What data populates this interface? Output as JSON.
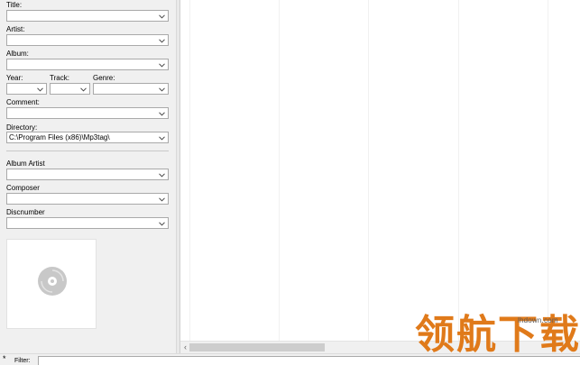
{
  "tag_panel": {
    "title_label": "Title:",
    "artist_label": "Artist:",
    "album_label": "Album:",
    "year_label": "Year:",
    "track_label": "Track:",
    "genre_label": "Genre:",
    "comment_label": "Comment:",
    "directory_label": "Directory:",
    "directory_value": "C:\\Program Files (x86)\\Mp3tag\\",
    "album_artist_label": "Album Artist",
    "composer_label": "Composer",
    "discnumber_label": "Discnumber",
    "cover_icon": "disc-icon"
  },
  "filter_bar": {
    "marker": "*",
    "label": "Filter:",
    "value": ""
  },
  "watermark": {
    "url": "lhdown.com",
    "text": "领航下载"
  },
  "colors": {
    "panel_bg": "#f0f0f0",
    "field_border": "#a9a9a9",
    "watermark": "#e07a1a"
  }
}
